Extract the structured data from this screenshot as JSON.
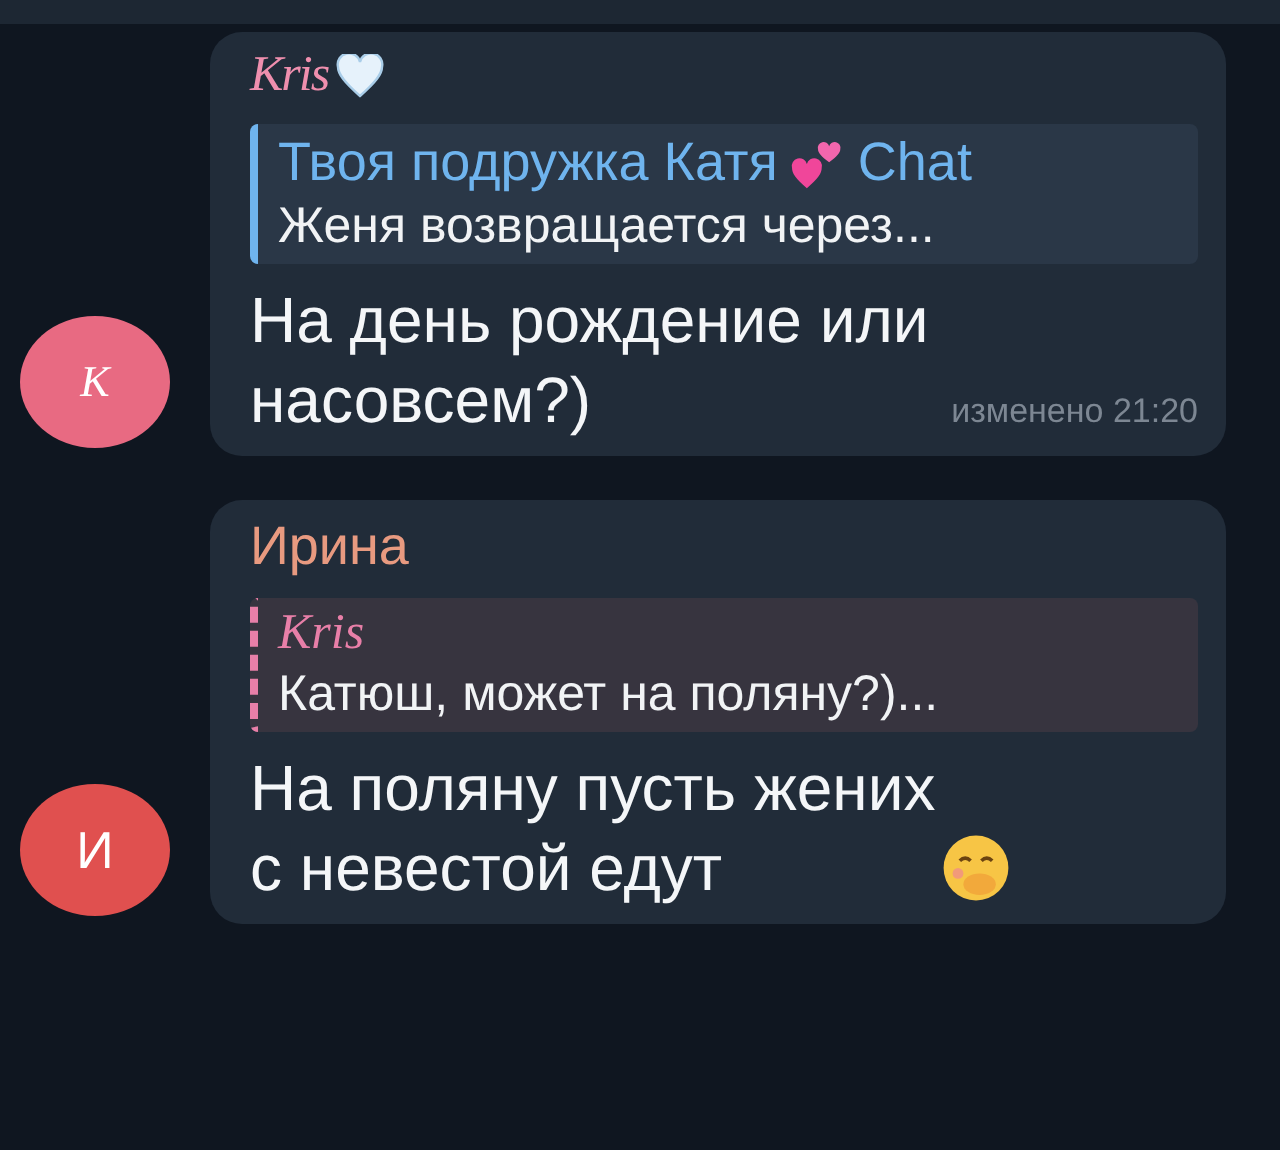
{
  "messages": [
    {
      "avatar": {
        "letter": "K",
        "kind": "fancy",
        "color": "#e86a82"
      },
      "sender": {
        "name": "Kris",
        "kind": "fancy",
        "heart": true,
        "color": "#ef8fae"
      },
      "reply": {
        "kind": "solid",
        "color": "#6fb4ee",
        "author": {
          "name": "Твоя подружка Катя",
          "kind": "plain",
          "hearts": true,
          "suffix": "Chat"
        },
        "text": "Женя возвращается через..."
      },
      "lines": [
        "На день рождение или",
        "насовсем?)"
      ],
      "time": "изменено 21:20"
    },
    {
      "avatar": {
        "letter": "И",
        "kind": "plain",
        "color": "#e0504f"
      },
      "sender": {
        "name": "Ирина",
        "kind": "plain",
        "color": "#e89a80"
      },
      "reply": {
        "kind": "striped",
        "color": "#e87fa8",
        "author": {
          "name": "Kris",
          "kind": "fancy"
        },
        "text": "Катюш, может на поляну?)..."
      },
      "lines": [
        "На поляну пусть жених",
        "с невестой едут"
      ],
      "emoji": true
    }
  ]
}
